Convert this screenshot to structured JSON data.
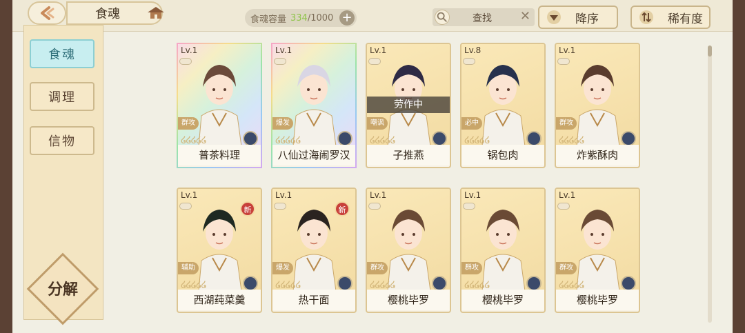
{
  "header": {
    "title": "食魂",
    "capacity_label": "食魂容量",
    "capacity_current": "334",
    "capacity_total": "/1000",
    "capacity_add": "+",
    "search_label": "查找",
    "search_clear": "✕",
    "sort_order_label": "降序",
    "sort_rarity_label": "稀有度"
  },
  "sidebar": {
    "tabs": [
      {
        "label": "食魂",
        "active": true
      },
      {
        "label": "调理",
        "active": false
      },
      {
        "label": "信物",
        "active": false
      }
    ],
    "decompose_label": "分解"
  },
  "cards": [
    {
      "lv": "Lv.1",
      "name": "普茶料理",
      "role": "群攻",
      "stars": "໒໒໒໒໒",
      "frame": "rainbow",
      "hair": "#6b4a3a",
      "bg": "#f2e7c6",
      "busy": "",
      "new": false
    },
    {
      "lv": "Lv.1",
      "name": "八仙过海闹罗汉",
      "role": "爆发",
      "stars": "໒໒໒໒໒",
      "frame": "rainbow",
      "hair": "#d9d6e4",
      "bg": "#efe6cf",
      "busy": "",
      "new": false
    },
    {
      "lv": "Lv.1",
      "name": "子推燕",
      "role": "嘲讽",
      "stars": "໒໒໒໒໒",
      "frame": "gold",
      "hair": "#2e2a45",
      "bg": "#f3dca4",
      "busy": "劳作中",
      "new": false
    },
    {
      "lv": "Lv.8",
      "name": "锅包肉",
      "role": "必中",
      "stars": "໒໒໒໒໒",
      "frame": "gold",
      "hair": "#27314d",
      "bg": "#f3dca4",
      "busy": "",
      "new": false
    },
    {
      "lv": "Lv.1",
      "name": "炸紫酥肉",
      "role": "群攻",
      "stars": "໒໒໒໒໒",
      "frame": "gold",
      "hair": "#5a3c2e",
      "bg": "#f3dca4",
      "busy": "",
      "new": false
    },
    {
      "lv": "Lv.1",
      "name": "西湖莼菜羹",
      "role": "辅助",
      "stars": "໒໒໒໒໒",
      "frame": "gold",
      "hair": "#1f2a22",
      "bg": "#f3dca4",
      "busy": "",
      "new": true,
      "new_label": "新"
    },
    {
      "lv": "Lv.1",
      "name": "热干面",
      "role": "爆发",
      "stars": "໒໒໒໒໒",
      "frame": "gold",
      "hair": "#2a2320",
      "bg": "#f3dca4",
      "busy": "",
      "new": true,
      "new_label": "新"
    },
    {
      "lv": "Lv.1",
      "name": "樱桃毕罗",
      "role": "群攻",
      "stars": "໒໒໒໒໒",
      "frame": "gold",
      "hair": "#6a4a35",
      "bg": "#f3dca4",
      "busy": "",
      "new": false
    },
    {
      "lv": "Lv.1",
      "name": "樱桃毕罗",
      "role": "群攻",
      "stars": "໒໒໒໒໒",
      "frame": "gold",
      "hair": "#6a4a35",
      "bg": "#f3dca4",
      "busy": "",
      "new": false
    },
    {
      "lv": "Lv.1",
      "name": "樱桃毕罗",
      "role": "群攻",
      "stars": "໒໒໒໒໒",
      "frame": "gold",
      "hair": "#6a4a35",
      "bg": "#f3dca4",
      "busy": "",
      "new": false
    }
  ]
}
